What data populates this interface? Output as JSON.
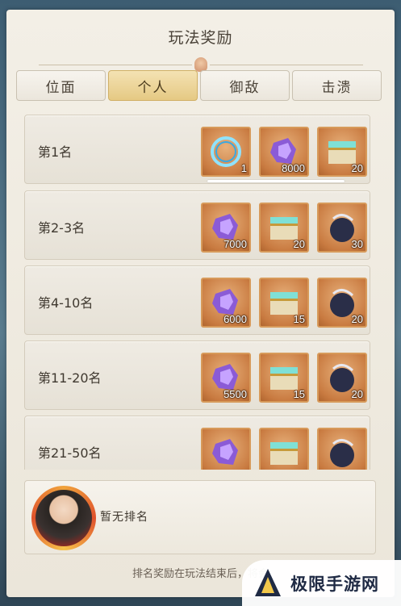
{
  "header": {
    "title": "玩法奖励"
  },
  "tabs": [
    {
      "label": "位面",
      "active": false
    },
    {
      "label": "个人",
      "active": true
    },
    {
      "label": "御敌",
      "active": false
    },
    {
      "label": "击溃",
      "active": false
    }
  ],
  "rewards": [
    {
      "rank": "第1名",
      "items": [
        {
          "icon": "portal-ring-icon",
          "qty": "1"
        },
        {
          "icon": "purple-crystal-icon",
          "qty": "8000"
        },
        {
          "icon": "treasure-chest-icon",
          "qty": "20"
        }
      ],
      "progress": 1.0
    },
    {
      "rank": "第2-3名",
      "items": [
        {
          "icon": "purple-crystal-icon",
          "qty": "7000"
        },
        {
          "icon": "treasure-chest-icon",
          "qty": "20"
        },
        {
          "icon": "dark-orb-icon",
          "qty": "30"
        }
      ]
    },
    {
      "rank": "第4-10名",
      "items": [
        {
          "icon": "purple-crystal-icon",
          "qty": "6000"
        },
        {
          "icon": "treasure-chest-icon",
          "qty": "15"
        },
        {
          "icon": "dark-orb-icon",
          "qty": "20"
        }
      ]
    },
    {
      "rank": "第11-20名",
      "items": [
        {
          "icon": "purple-crystal-icon",
          "qty": "5500"
        },
        {
          "icon": "treasure-chest-icon",
          "qty": "15"
        },
        {
          "icon": "dark-orb-icon",
          "qty": "20"
        }
      ]
    },
    {
      "rank": "第21-50名",
      "items": [
        {
          "icon": "purple-crystal-icon",
          "qty": ""
        },
        {
          "icon": "treasure-chest-icon",
          "qty": ""
        },
        {
          "icon": "dark-orb-icon",
          "qty": ""
        }
      ]
    }
  ],
  "my_rank": {
    "text": "暂无排名"
  },
  "footer": {
    "note": "排名奖励在玩法结束后，将会"
  },
  "watermark": {
    "text": "极限手游网"
  },
  "colors": {
    "accent": "#e5c983",
    "item_frame": "#d79a5a",
    "text": "#3f382f"
  }
}
